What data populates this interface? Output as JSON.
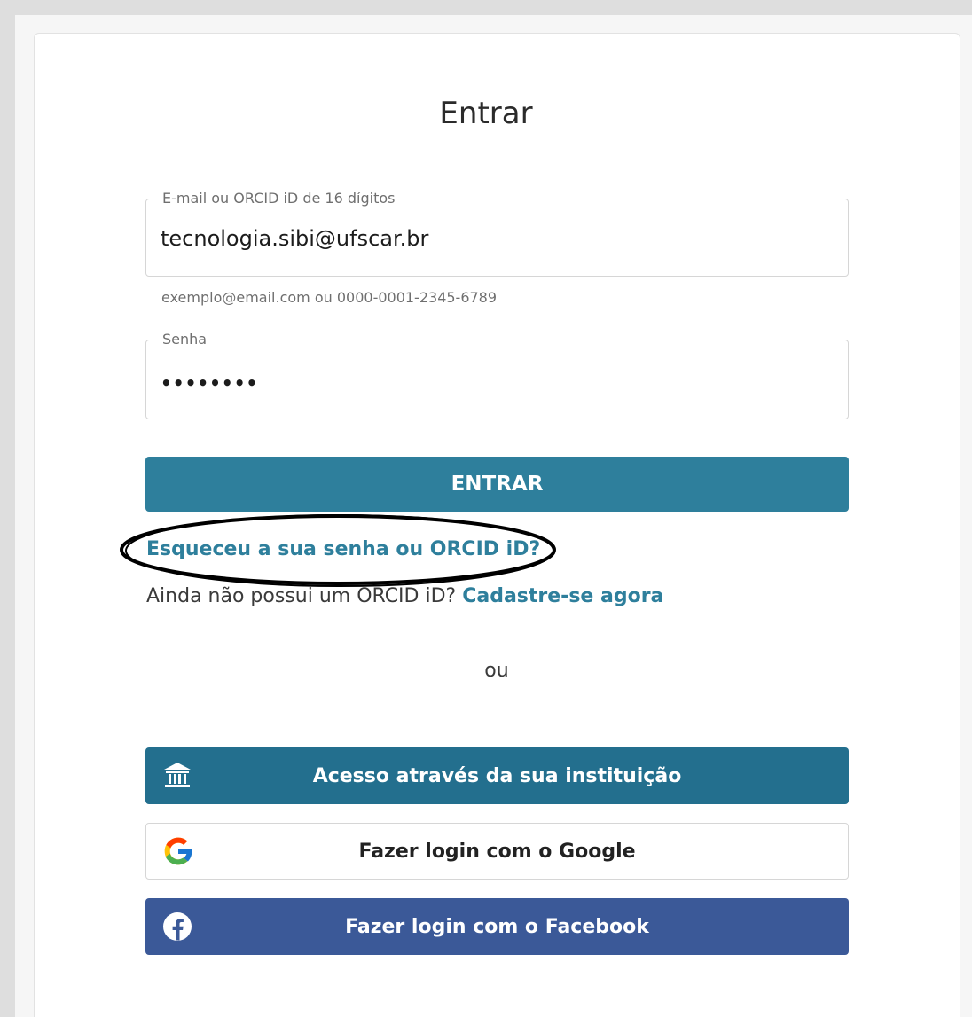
{
  "login": {
    "title": "Entrar",
    "email_field": {
      "label": "E-mail ou ORCID iD de 16 dígitos",
      "value": "tecnologia.sibi@ufscar.br",
      "helper": "exemplo@email.com ou 0000-0001-2345-6789"
    },
    "password_field": {
      "label": "Senha",
      "value": "••••••••"
    },
    "submit_label": "ENTRAR",
    "forgot_link": "Esqueceu a sua senha ou ORCID iD?",
    "register_prompt": "Ainda não possui um ORCID iD?",
    "register_link": "Cadastre-se agora",
    "or_divider": "ou",
    "institution_button": "Acesso através da sua instituição",
    "google_button": "Fazer login com o Google",
    "facebook_button": "Fazer login com o Facebook"
  },
  "icons": {
    "institution": "institution-icon",
    "google": "google-icon",
    "facebook": "facebook-icon"
  },
  "colors": {
    "primary": "#2e7f9c",
    "institution": "#236f8e",
    "facebook": "#3b5998"
  }
}
